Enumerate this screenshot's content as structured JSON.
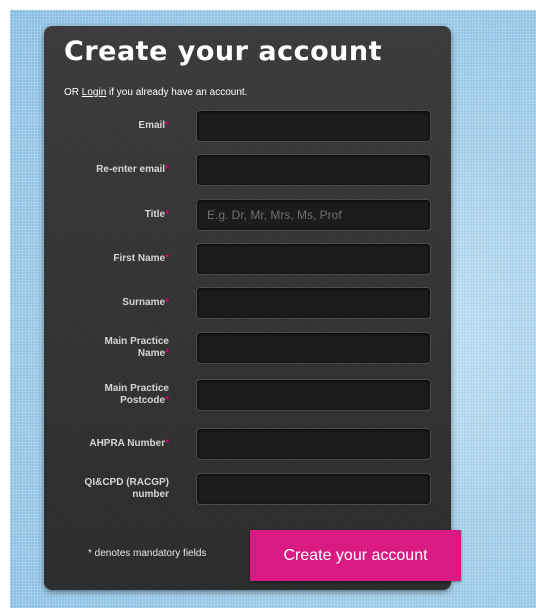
{
  "form": {
    "title": "Create your account",
    "login_prefix": "OR ",
    "login_link": "Login",
    "login_suffix": " if you already have an account.",
    "required_marker": "*",
    "fields": [
      {
        "label": "Email",
        "value": "",
        "placeholder": ""
      },
      {
        "label": "Re-enter email",
        "value": "",
        "placeholder": ""
      },
      {
        "label": "Title",
        "value": "",
        "placeholder": "E.g. Dr, Mr, Mrs, Ms, Prof"
      },
      {
        "label": "First Name",
        "value": "",
        "placeholder": ""
      },
      {
        "label": "Surname",
        "value": "",
        "placeholder": ""
      },
      {
        "label_line1": "Main Practice",
        "label_line2": "Name",
        "value": "",
        "placeholder": ""
      },
      {
        "label_line1": "Main Practice",
        "label_line2": "Postcode",
        "value": "",
        "placeholder": ""
      },
      {
        "label": "AHPRA Number",
        "value": "",
        "placeholder": ""
      },
      {
        "label_line1": "QI&CPD (RACGP)",
        "label_line2": "number",
        "value": "",
        "placeholder": ""
      }
    ],
    "mandatory_note": "* denotes mandatory fields",
    "submit_label": "Create your account"
  },
  "colors": {
    "accent": "#d81a82",
    "required": "#e0006b",
    "panel": "#2f2f2f",
    "background": "#9fcbe8"
  }
}
